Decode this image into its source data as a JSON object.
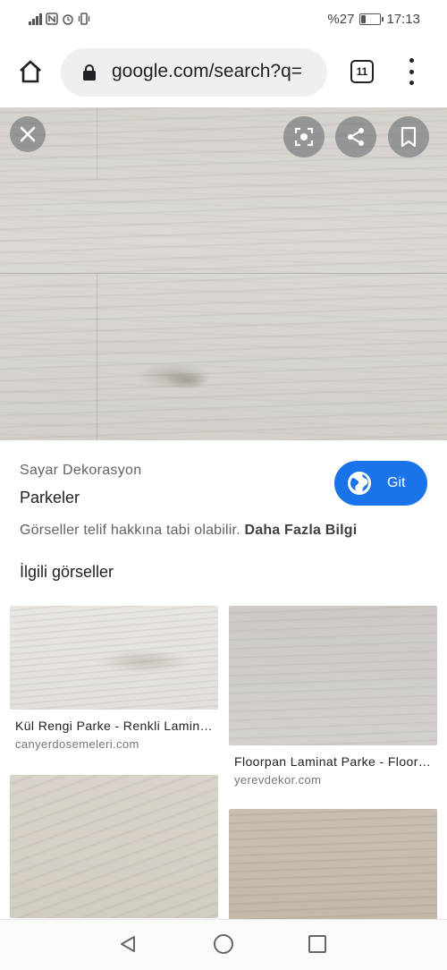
{
  "status_bar": {
    "battery_text": "%27",
    "battery_level": 0.27,
    "time": "17:13"
  },
  "browser": {
    "url": "google.com/search?q=",
    "tab_count": "11",
    "icons": [
      "home-icon",
      "lock-icon",
      "tab-switcher-icon",
      "more-vert-icon"
    ]
  },
  "viewer": {
    "icons": [
      "close-icon",
      "lens-icon",
      "share-icon",
      "bookmark-icon"
    ]
  },
  "result": {
    "source": "Sayar Dekorasyon",
    "title": "Parkeler",
    "visit_label": "Git",
    "copyright_text": "Görseller telif hakkına tabi olabilir.",
    "more_info_link": "Daha Fazla Bilgi"
  },
  "related": {
    "heading": "İlgili görseller",
    "items": [
      {
        "title": "Kül Rengi Parke - Renkli Laminat Parke",
        "site": "canyerdosemeleri.com"
      },
      {
        "title": "Floorpan Laminat Parke - Floorpan",
        "site": "yerevdekor.com"
      },
      {
        "title": "",
        "site": ""
      },
      {
        "title": "",
        "site": ""
      }
    ]
  },
  "nav_bar": {
    "icons": [
      "back-triangle-icon",
      "home-circle-icon",
      "recents-square-icon"
    ]
  },
  "colors": {
    "accent": "#1a73e8",
    "text_primary": "#202124",
    "text_secondary": "#5f6368"
  }
}
